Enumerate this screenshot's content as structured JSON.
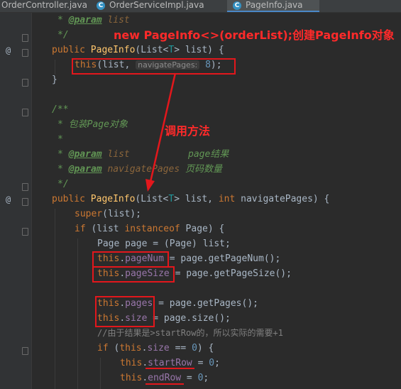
{
  "tabs": [
    {
      "label": "OrderController.java"
    },
    {
      "label": "OrderServiceImpl.java",
      "icon": "C"
    },
    {
      "label": "PageInfo.java",
      "icon": "C",
      "active": true
    }
  ],
  "gutter": {
    "override_mark": "@"
  },
  "code": {
    "l1": {
      "tag": "@param",
      "name": "list"
    },
    "l2": {
      "text": "*/"
    },
    "l3": {
      "public": "public",
      "ctor": "PageInfo",
      "open": "(List<",
      "type_param": "T",
      "rest": "> list) {"
    },
    "l4": {
      "this": "this",
      "args": "(list, ",
      "hint": "navigatePages:",
      "num": "8",
      "close": ");"
    },
    "l5": {
      "text": "}"
    },
    "l7": {
      "text": "/**"
    },
    "l8": {
      "star": "* ",
      "desc": "包装Page对象"
    },
    "l9": {
      "text": "*"
    },
    "l10": {
      "tag": "@param",
      "name": "list",
      "desc": "page结果"
    },
    "l11": {
      "tag": "@param",
      "name": "navigatePages",
      "desc": "页码数量"
    },
    "l12": {
      "text": "*/"
    },
    "l13": {
      "public": "public",
      "ctor": "PageInfo",
      "open": "(List<",
      "type_param": "T",
      "mid": "> list, ",
      "int": "int",
      "rest": " navigatePages) {"
    },
    "l14": {
      "super": "super",
      "rest": "(list);"
    },
    "l15": {
      "if": "if",
      "open": " (list ",
      "instanceof": "instanceof",
      "rest": " Page) {"
    },
    "l16": {
      "text": "Page page = (Page) list;"
    },
    "l17": {
      "this": "this",
      "field": "pageNum",
      "rest": " = page.getPageNum();"
    },
    "l18": {
      "this": "this",
      "field": "pageSize",
      "rest": " = page.getPageSize();"
    },
    "l20": {
      "this": "this",
      "field": "pages",
      "rest": " = page.getPages();"
    },
    "l21": {
      "this": "this",
      "field": "size",
      "rest": " = page.size();"
    },
    "l22": {
      "text": "//由于结果是>startRow的，所以实际的需要+1"
    },
    "l23": {
      "if": "if",
      "open": " (",
      "this": "this",
      "field": "size",
      "mid": " == ",
      "num": "0",
      "rest": ") {"
    },
    "l24": {
      "this": "this",
      "field": "startRow",
      "mid": " = ",
      "num": "0",
      "rest": ";"
    },
    "l25": {
      "this": "this",
      "field": "endRow",
      "mid": " = ",
      "num": "0",
      "rest": ";"
    }
  },
  "annotations": {
    "top": "new PageInfo<>(orderList);创建PageInfo对象",
    "middle": "调用方法"
  },
  "colors": {
    "highlight": "#e3171c",
    "keyword": "#cc7832",
    "method": "#ffc66d",
    "field": "#9876aa",
    "doc_comment": "#629755"
  }
}
